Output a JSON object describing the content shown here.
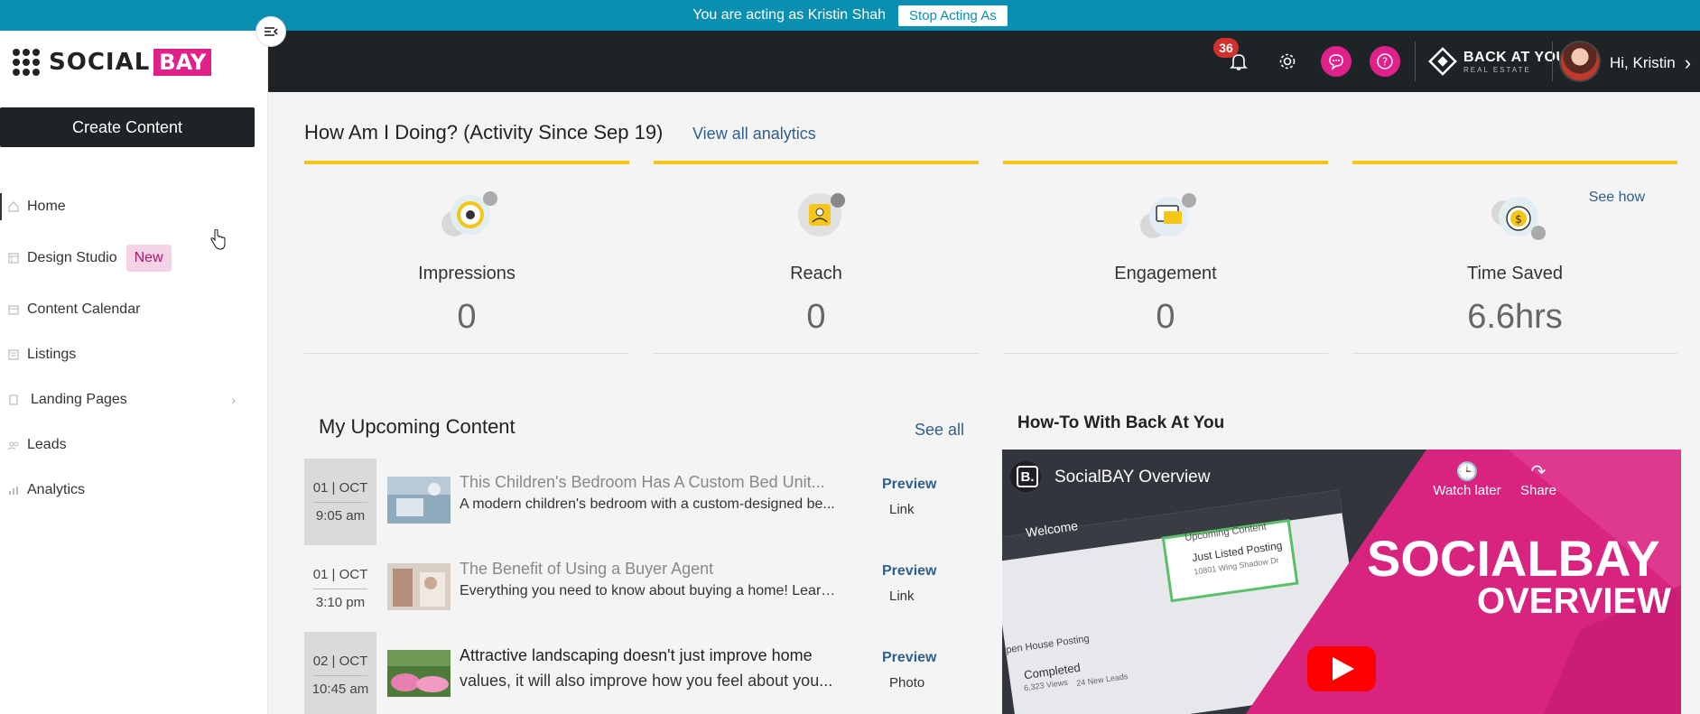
{
  "banner": {
    "text": "You are acting as Kristin Shah",
    "stop_label": "Stop Acting As"
  },
  "brand": {
    "social": "SOCIAL",
    "bay": "BAY"
  },
  "sidebar": {
    "create_label": "Create Content",
    "items": [
      {
        "label": "Home",
        "icon": "home-icon",
        "active": true
      },
      {
        "label": "Design Studio",
        "icon": "design-icon",
        "badge": "New"
      },
      {
        "label": "Content Calendar",
        "icon": "calendar-icon"
      },
      {
        "label": "Listings",
        "icon": "list-icon"
      },
      {
        "label": "Landing Pages",
        "icon": "page-icon",
        "has_children": true
      },
      {
        "label": "Leads",
        "icon": "leads-icon"
      },
      {
        "label": "Analytics",
        "icon": "analytics-icon"
      }
    ]
  },
  "header": {
    "notification_count": "36",
    "logo_main": "BACK AT YOU",
    "logo_sub": "REAL ESTATE",
    "greeting": "Hi, Kristin"
  },
  "analytics": {
    "title": "How Am I Doing? (Activity Since Sep 19)",
    "view_all": "View all analytics",
    "see_how": "See how",
    "stats": [
      {
        "label": "Impressions",
        "value": "0"
      },
      {
        "label": "Reach",
        "value": "0"
      },
      {
        "label": "Engagement",
        "value": "0"
      },
      {
        "label": "Time Saved",
        "value": "6.6hrs"
      }
    ]
  },
  "upcoming": {
    "title": "My Upcoming Content",
    "see_all": "See all",
    "items": [
      {
        "date": "01 | OCT",
        "time": "9:05 am",
        "title": "This Children's Bedroom Has A Custom Bed Unit...",
        "desc": "A modern children's bedroom with a custom-designed be...",
        "preview": "Preview",
        "kind": "Link"
      },
      {
        "date": "01 | OCT",
        "time": "3:10 pm",
        "title": "The Benefit of Using a Buyer Agent",
        "desc": "Everything you need to know about buying a home! Learn...",
        "preview": "Preview",
        "kind": "Link"
      },
      {
        "date": "02 | OCT",
        "time": "10:45 am",
        "title": "Attractive landscaping doesn't just improve home",
        "desc": "values, it will also improve how you feel about you...",
        "preview": "Preview",
        "kind": "Photo"
      }
    ]
  },
  "howto": {
    "title": "How-To With Back At You",
    "video_title": "SocialBAY Overview",
    "watch_later": "Watch later",
    "share": "Share",
    "overlay_big": "SOCIALBAY",
    "overlay_small": "OVERVIEW",
    "screen_welcome": "Welcome",
    "screen_upcoming": "Upcoming Content",
    "screen_listed": "Just Listed Posting",
    "screen_address": "10801 Wing Shadow Dr",
    "screen_openhouse": "pen House Posting",
    "screen_completed": "Completed",
    "screen_views": "6,323 Views",
    "screen_leads": "24 New Leads",
    "screen_channel_letter": "B."
  },
  "colors": {
    "accent": "#e0218a",
    "banner": "#0a8fb0",
    "header": "#1e2326",
    "card_top": "#f5c518",
    "link": "#2f5f8e"
  }
}
